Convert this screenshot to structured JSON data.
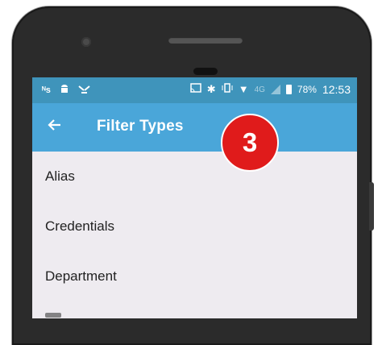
{
  "status_bar": {
    "left_icons": [
      "ts-icon",
      "android-icon",
      "wifi-off-icon"
    ],
    "right_icons": [
      "cast-icon",
      "bluetooth-icon",
      "vibrate-icon",
      "wifi-icon",
      "signal-icon",
      "battery-icon"
    ],
    "network_type": "4G",
    "battery_percent": "78%",
    "time": "12:53"
  },
  "app_bar": {
    "back_icon": "arrow-left-icon",
    "title": "Filter Types"
  },
  "annotation_badge": "3",
  "list": {
    "items": [
      {
        "label": "Alias"
      },
      {
        "label": "Credentials"
      },
      {
        "label": "Department"
      }
    ]
  },
  "colors": {
    "status_bar": "#3f94bb",
    "app_bar": "#4aa6d9",
    "badge": "#e01b1b",
    "list_background": "#eeebf0"
  }
}
